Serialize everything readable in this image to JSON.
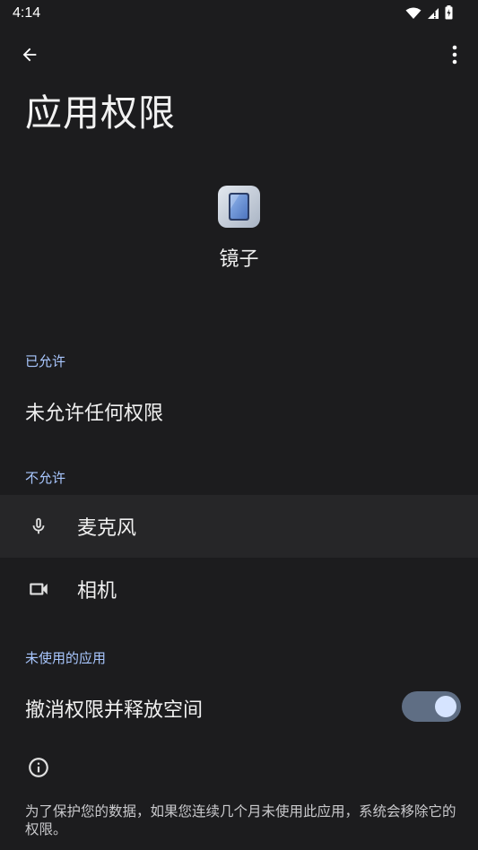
{
  "status_bar": {
    "time": "4:14"
  },
  "app_bar": {
    "title": "应用权限"
  },
  "app": {
    "name": "镜子"
  },
  "sections": {
    "allowed": {
      "header": "已允许",
      "empty_text": "未允许任何权限"
    },
    "denied": {
      "header": "不允许",
      "items": [
        {
          "label": "麦克风",
          "icon": "microphone-icon"
        },
        {
          "label": "相机",
          "icon": "camera-icon"
        }
      ]
    },
    "unused": {
      "header": "未使用的应用",
      "toggle_label": "撤消权限并释放空间",
      "toggle_on": true
    }
  },
  "footer": {
    "text": "为了保护您的数据，如果您连续几个月未使用此应用，系统会移除它的权限。"
  },
  "colors": {
    "background": "#1c1c1e",
    "accent": "#a9c7ff",
    "switch_track": "#5f6e84",
    "switch_thumb": "#d6e4ff"
  }
}
